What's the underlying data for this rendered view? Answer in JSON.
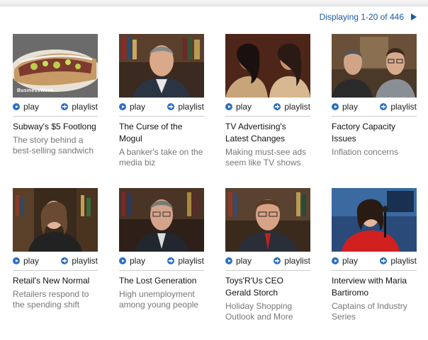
{
  "header": {
    "pager_text": "Displaying 1-20 of 446",
    "next_icon": "next-arrow-icon"
  },
  "labels": {
    "play": "play",
    "playlist": "playlist"
  },
  "colors": {
    "link_blue": "#1a5aa6",
    "icon_blue": "#2a6fc2",
    "desc_gray": "#777777"
  },
  "videos": [
    {
      "title": "Subway's $5 Footlong",
      "desc": "The story behind a best-selling sandwich",
      "watermark": "BusinessWeek"
    },
    {
      "title": "The Curse of the Mogul",
      "desc": "A banker's take on the media biz"
    },
    {
      "title": "TV Advertising's Latest Changes",
      "desc": "Making must-see ads seem like TV shows"
    },
    {
      "title": "Factory Capacity Issues",
      "desc": "Inflation concerns"
    },
    {
      "title": "Retail's New Normal",
      "desc": "Retailers respond to the spending shift"
    },
    {
      "title": "The Lost Generation",
      "desc": "High unemployment among young people"
    },
    {
      "title": "Toys'R'Us CEO Gerald Storch",
      "desc": "Holiday Shopping Outlook and More"
    },
    {
      "title": "Interview with Maria Bartiromo",
      "desc": "Captains of Industry Series"
    }
  ]
}
